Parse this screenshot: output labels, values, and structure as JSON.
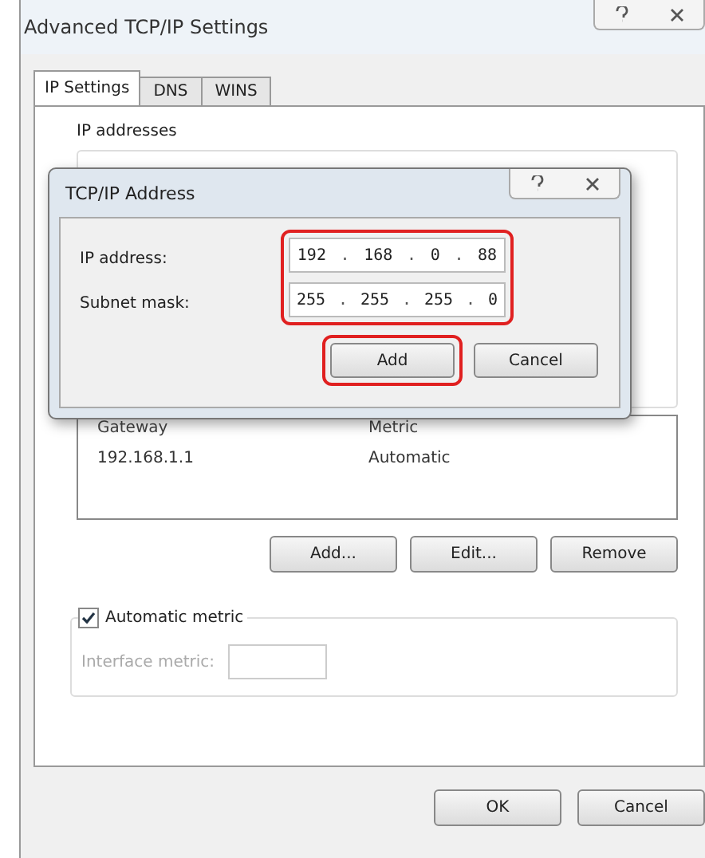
{
  "window": {
    "title": "Advanced TCP/IP Settings",
    "buttons": [
      "OK",
      "Cancel"
    ]
  },
  "tabs": [
    {
      "label": "IP Settings",
      "selected": true
    },
    {
      "label": "DNS",
      "selected": false
    },
    {
      "label": "WINS",
      "selected": false
    }
  ],
  "ip_addresses": {
    "title": "IP addresses"
  },
  "gateways": {
    "columns": [
      "Gateway",
      "Metric"
    ],
    "rows": [
      [
        "192.168.1.1",
        "Automatic"
      ]
    ],
    "buttons": [
      "Add...",
      "Edit...",
      "Remove"
    ]
  },
  "automatic_metric": {
    "label": "Automatic metric",
    "checked": true
  },
  "interface_metric": {
    "label": "Interface metric:",
    "disabled": true
  },
  "dialog": {
    "title": "TCP/IP Address",
    "fields_highlighted": true,
    "separator": ".",
    "fields": [
      {
        "label": "IP address:",
        "octets": [
          "192",
          "168",
          "0",
          "88"
        ]
      },
      {
        "label": "Subnet mask:",
        "octets": [
          "255",
          "255",
          "255",
          "0"
        ]
      }
    ],
    "buttons": [
      {
        "label": "Add",
        "highlighted": true
      },
      {
        "label": "Cancel",
        "highlighted": false
      }
    ]
  }
}
